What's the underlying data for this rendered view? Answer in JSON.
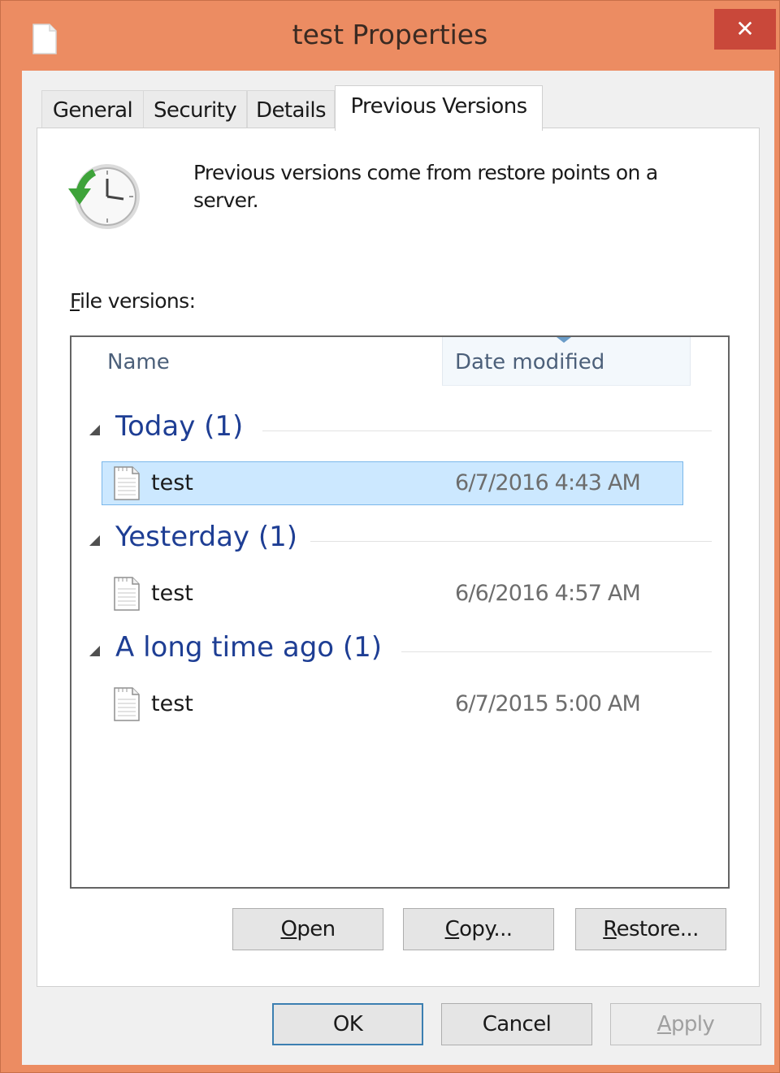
{
  "window": {
    "title": "test Properties",
    "close_glyph": "✕",
    "icons": {
      "title": "document-icon",
      "close": "close-icon"
    }
  },
  "tabs": [
    {
      "label": "General",
      "active": false
    },
    {
      "label": "Security",
      "active": false
    },
    {
      "label": "Details",
      "active": false
    },
    {
      "label": "Previous Versions",
      "active": true
    }
  ],
  "info": {
    "icon": "restore-clock-icon",
    "text": "Previous versions come from restore points on a server."
  },
  "versions": {
    "label": "File versions:",
    "label_accel": "F",
    "columns": {
      "name": "Name",
      "date": "Date modified"
    },
    "sorted_column": "Date modified",
    "groups": [
      {
        "title": "Today (1)",
        "items": [
          {
            "name": "test",
            "date": "6/7/2016 4:43 AM",
            "selected": true
          }
        ]
      },
      {
        "title": "Yesterday (1)",
        "items": [
          {
            "name": "test",
            "date": "6/6/2016 4:57 AM",
            "selected": false
          }
        ]
      },
      {
        "title": "A long time ago (1)",
        "items": [
          {
            "name": "test",
            "date": "6/7/2015 5:00 AM",
            "selected": false
          }
        ]
      }
    ]
  },
  "actions": {
    "open": "Open",
    "copy": "Copy...",
    "restore": "Restore..."
  },
  "footer": {
    "ok": "OK",
    "cancel": "Cancel",
    "apply": "Apply",
    "apply_enabled": false
  },
  "colors": {
    "window_frame": "#ec8c62",
    "close_button": "#c9483a",
    "group_header": "#1e3e94",
    "selection": "#cce8ff",
    "selection_border": "#7ab7ea"
  }
}
